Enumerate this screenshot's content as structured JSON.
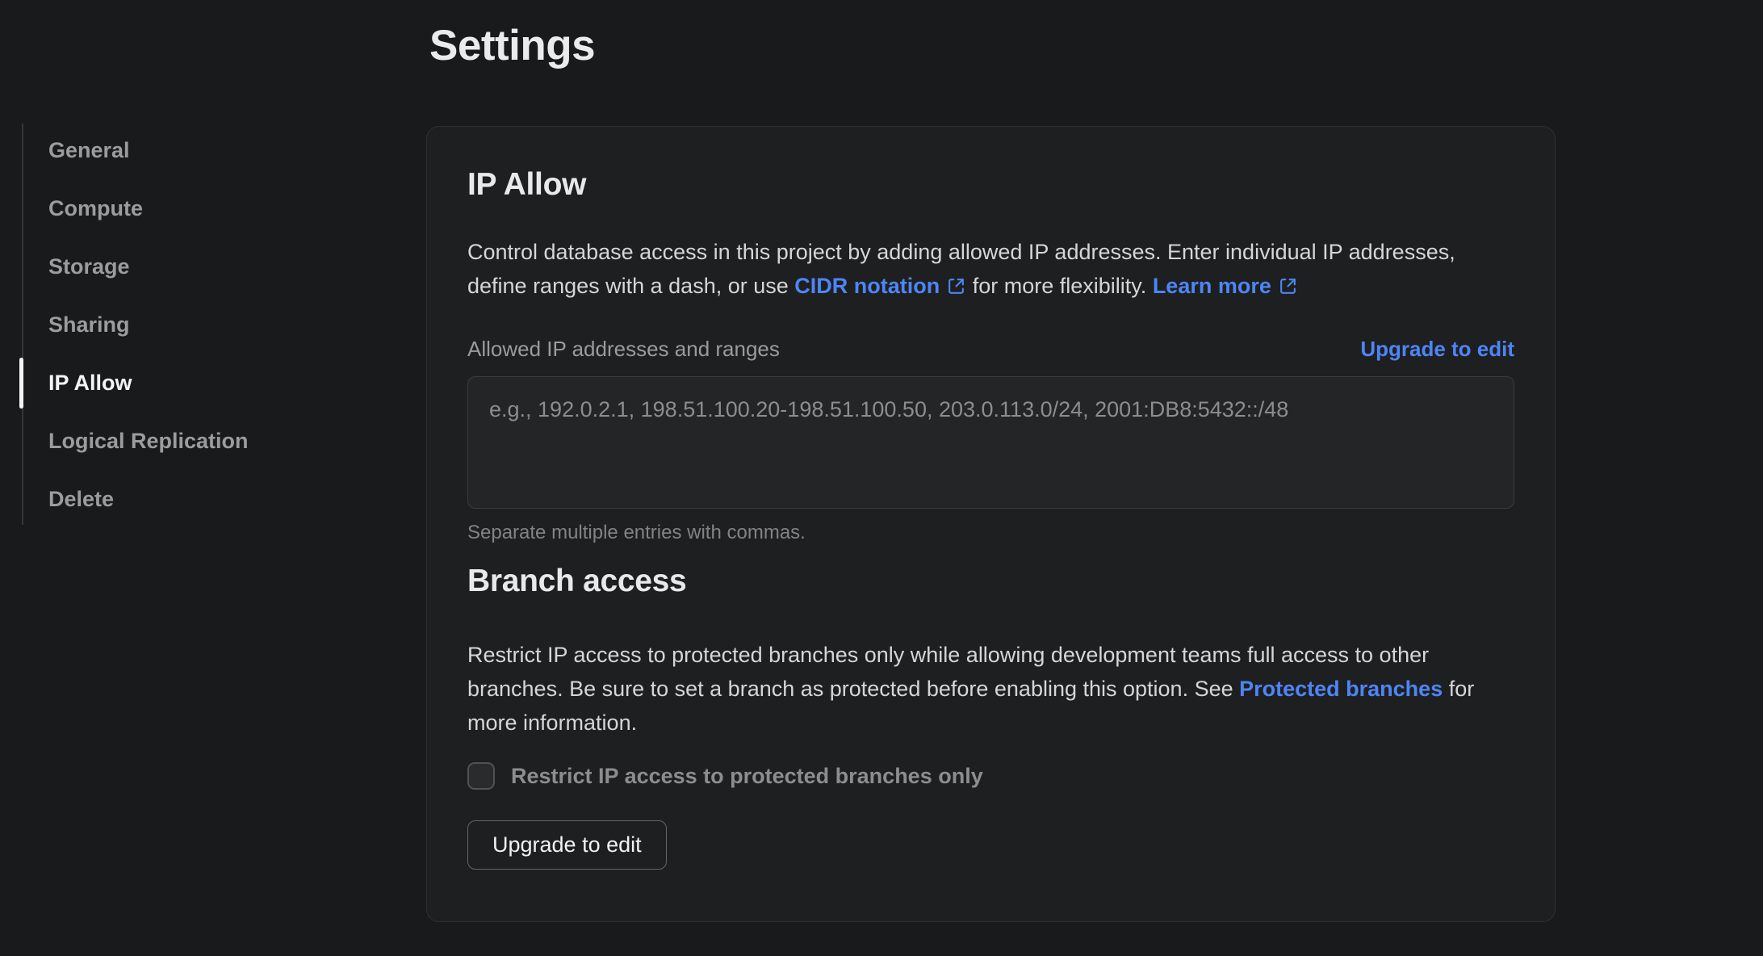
{
  "page": {
    "title": "Settings"
  },
  "colors": {
    "accent_blue": "#4e85f6",
    "active_item": "#f5f5f5",
    "card_bg": "#1e1f20"
  },
  "sidebar": {
    "items": [
      {
        "label": "General",
        "active": false
      },
      {
        "label": "Compute",
        "active": false
      },
      {
        "label": "Storage",
        "active": false
      },
      {
        "label": "Sharing",
        "active": false
      },
      {
        "label": "IP Allow",
        "active": true
      },
      {
        "label": "Logical Replication",
        "active": false
      },
      {
        "label": "Delete",
        "active": false
      }
    ]
  },
  "ip_allow": {
    "heading": "IP Allow",
    "desc_part1": "Control database access in this project by adding allowed IP addresses. Enter individual IP addresses, define ranges with a dash, or use ",
    "cidr_link_label": "CIDR notation",
    "desc_part2": " for more flexibility. ",
    "learn_more_label": "Learn more",
    "field_label": "Allowed IP addresses and ranges",
    "upgrade_link_label": "Upgrade to edit",
    "textarea_value": "",
    "textarea_placeholder": "e.g., 192.0.2.1, 198.51.100.20-198.51.100.50, 203.0.113.0/24, 2001:DB8:5432::/48",
    "helper_text": "Separate multiple entries with commas."
  },
  "branch_access": {
    "heading": "Branch access",
    "desc_part1": "Restrict IP access to protected branches only while allowing development teams full access to other branches. Be sure to set a branch as protected before enabling this option. See ",
    "protected_link_label": "Protected branches",
    "desc_part2": " for more information.",
    "checkbox_label": "Restrict IP access to protected branches only",
    "checkbox_checked": false,
    "upgrade_button_label": "Upgrade to edit"
  }
}
